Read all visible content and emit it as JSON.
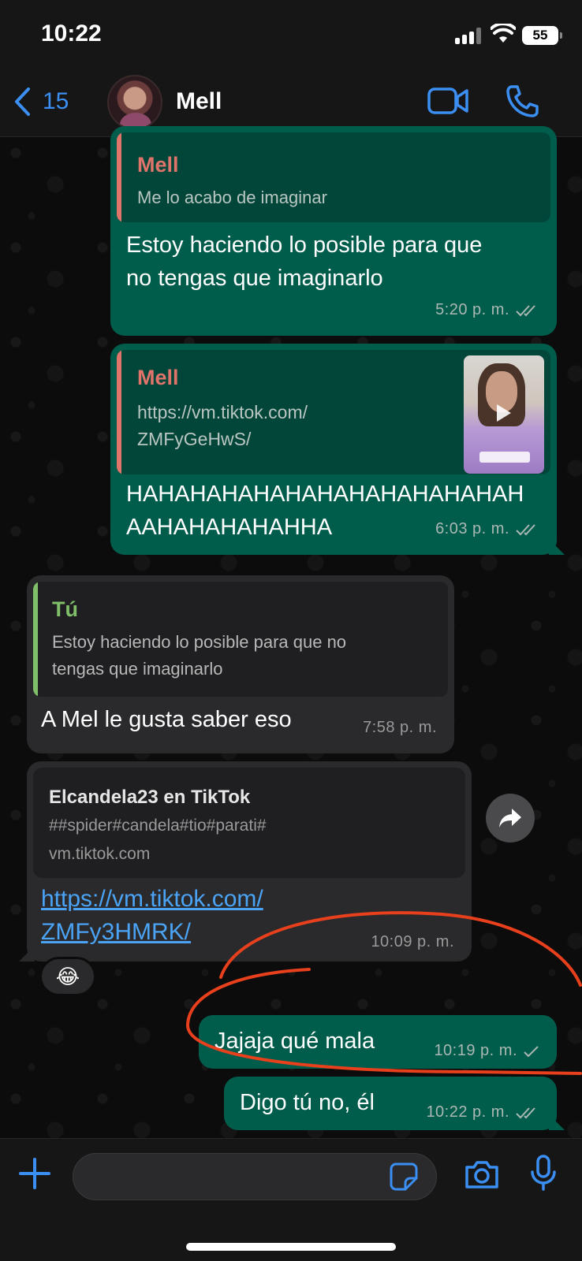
{
  "status_bar": {
    "time": "10:22",
    "battery": "55"
  },
  "header": {
    "back_count": "15",
    "contact_name": "Mell"
  },
  "messages": [
    {
      "type": "outgoing",
      "quote_author": "Mell",
      "quote_text": "Me lo acabo de imaginar",
      "text_lines": [
        "Estoy haciendo lo posible para que",
        "no tengas que imaginarlo"
      ],
      "time": "5:20 p. m.",
      "status": "read"
    },
    {
      "type": "outgoing",
      "quote_author": "Mell",
      "quote_text_lines": [
        "https://vm.tiktok.com/",
        "ZMFyGeHwS/"
      ],
      "text_lines": [
        "HAHAHAHAHAHAHAHAHAHAHAHAH",
        "AAHAHAHAHAHHA"
      ],
      "time": "6:03 p. m.",
      "status": "read"
    },
    {
      "type": "incoming",
      "quote_author": "Tú",
      "quote_text_lines": [
        "Estoy haciendo lo posible para que no",
        "tengas que imaginarlo"
      ],
      "text": "A Mel le gusta saber eso",
      "time": "7:58 p. m."
    },
    {
      "type": "incoming",
      "link_title": "Elcandela23 en TikTok",
      "link_desc": "##spider#candela#tio#parati#",
      "link_domain": "vm.tiktok.com",
      "url_lines": [
        "https://vm.tiktok.com/",
        "ZMFy3HMRK/"
      ],
      "time": "10:09 p. m.",
      "reaction": "😂"
    },
    {
      "type": "outgoing",
      "text": "Jajaja qué mala",
      "time": "10:19 p. m.",
      "status": "sent"
    },
    {
      "type": "outgoing",
      "text": "Digo tú no, él",
      "time": "10:22 p. m.",
      "status": "read"
    }
  ],
  "input": {
    "placeholder": ""
  },
  "colors": {
    "accent": "#3b8ff3",
    "outgoing_bubble": "#005c4b",
    "incoming_bubble": "#2a2a2c",
    "mell_name": "#e0736a",
    "tu_name": "#7fbf6a",
    "annotation": "#e8401c"
  }
}
